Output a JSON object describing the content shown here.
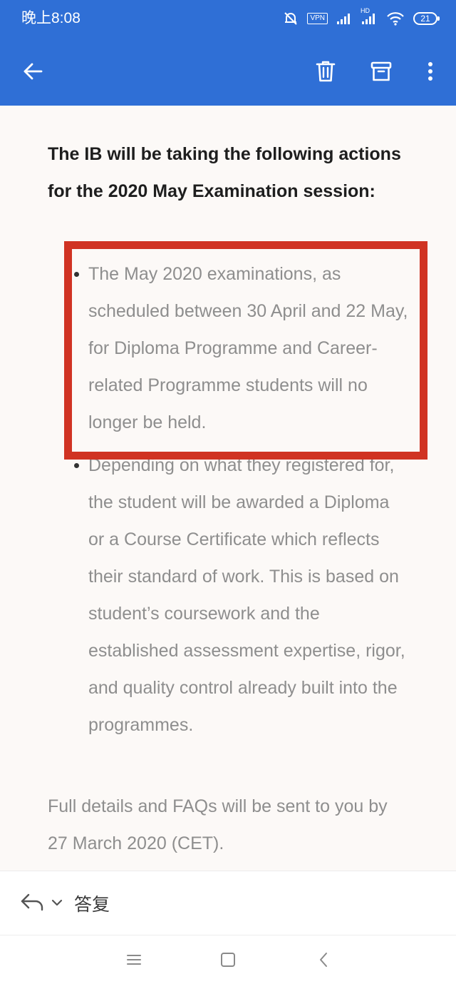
{
  "status_bar": {
    "time": "晚上8:08",
    "vpn_label": "VPN",
    "network_label": "HD",
    "battery": "21"
  },
  "toolbar": {
    "icons": {
      "back": "arrow-left-icon",
      "delete": "trash-icon",
      "archive": "archive-icon",
      "more": "more-vertical-icon"
    }
  },
  "email": {
    "heading": "The IB will be taking the following actions for the 2020 May Examination session:",
    "bullets": [
      "The May 2020 examinations, as scheduled between 30 April and 22 May, for Diploma Programme and Career-related Programme students will no longer be held.",
      "Depending on what they registered for, the student will be awarded a Diploma or a Course Certificate which reflects their standard of work. This is based on student’s coursework and the established assessment expertise, rigor, and quality control already built into the programmes."
    ],
    "footer": "Full details and FAQs will be sent to you by 27 March 2020 (CET)."
  },
  "reply_bar": {
    "label": "答复"
  },
  "colors": {
    "app_bar": "#2f6fd6",
    "highlight_border": "#d03323",
    "content_background": "#fcf9f7",
    "body_text": "#8e8e8e",
    "heading_text": "#1e1e1e"
  }
}
